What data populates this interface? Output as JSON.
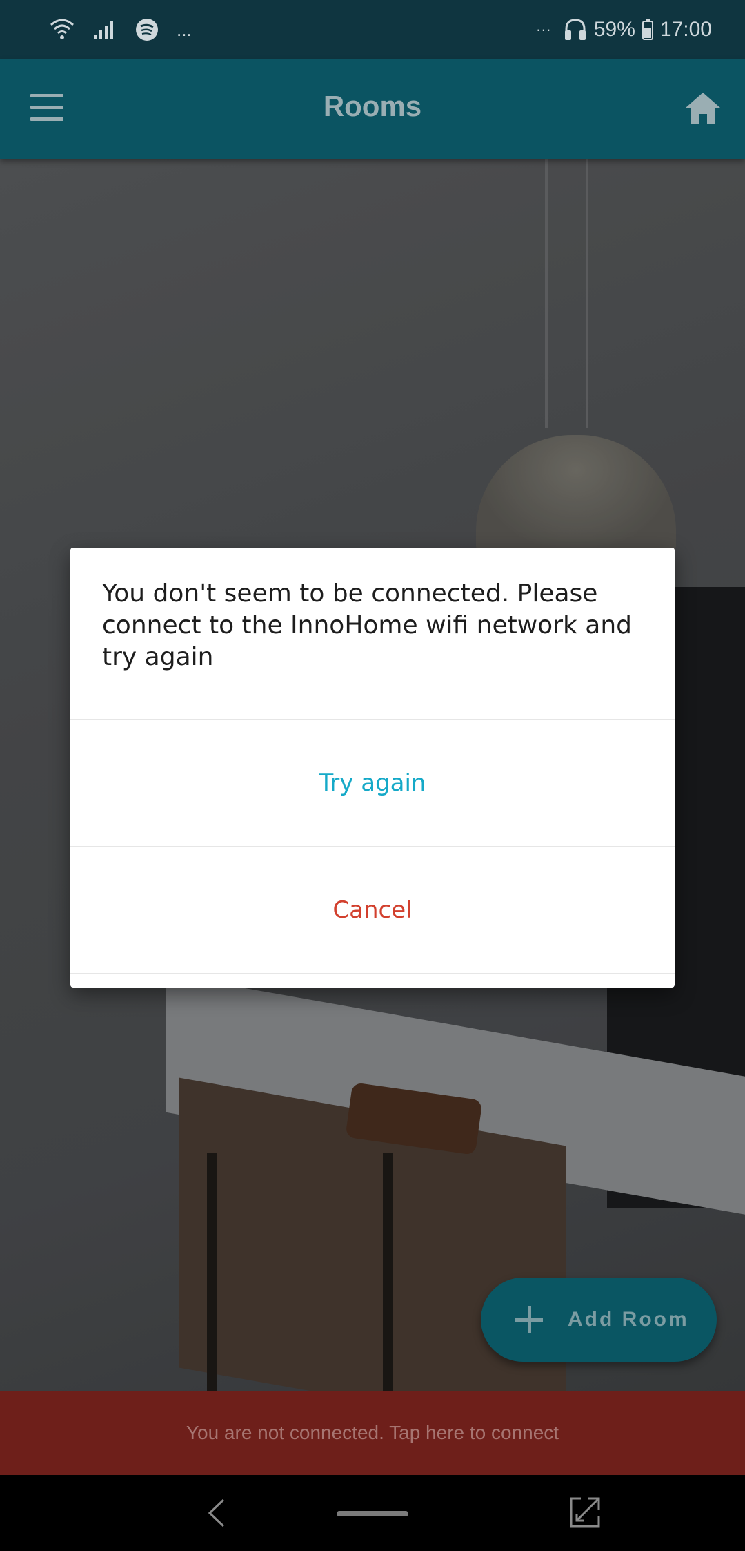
{
  "status_bar": {
    "battery": "59%",
    "time": "17:00",
    "more_glyph": "...",
    "notif_glyph": "···",
    "icons": [
      "wifi-icon",
      "signal-icon",
      "spotify-icon",
      "headphones-icon",
      "battery-icon"
    ]
  },
  "app_bar": {
    "title": "Rooms",
    "icons": [
      "menu-icon",
      "home-icon"
    ]
  },
  "dialog": {
    "message": "You don't seem to be connected. Please connect to the InnoHome wifi network and try again",
    "primary_label": "Try again",
    "secondary_label": "Cancel"
  },
  "fab": {
    "label": "Add Room",
    "icon": "plus-icon"
  },
  "snackbar": {
    "text": "You are not connected. Tap here to connect"
  },
  "nav_bar": {
    "icons": [
      "back-icon",
      "home-pill-icon",
      "screen-switch-icon"
    ]
  },
  "colors": {
    "app_bar": "#0b5462",
    "status_bar": "#0f3540",
    "primary_action": "#15a9c8",
    "destructive_action": "#d2402e",
    "snackbar": "#6e1f1a"
  }
}
